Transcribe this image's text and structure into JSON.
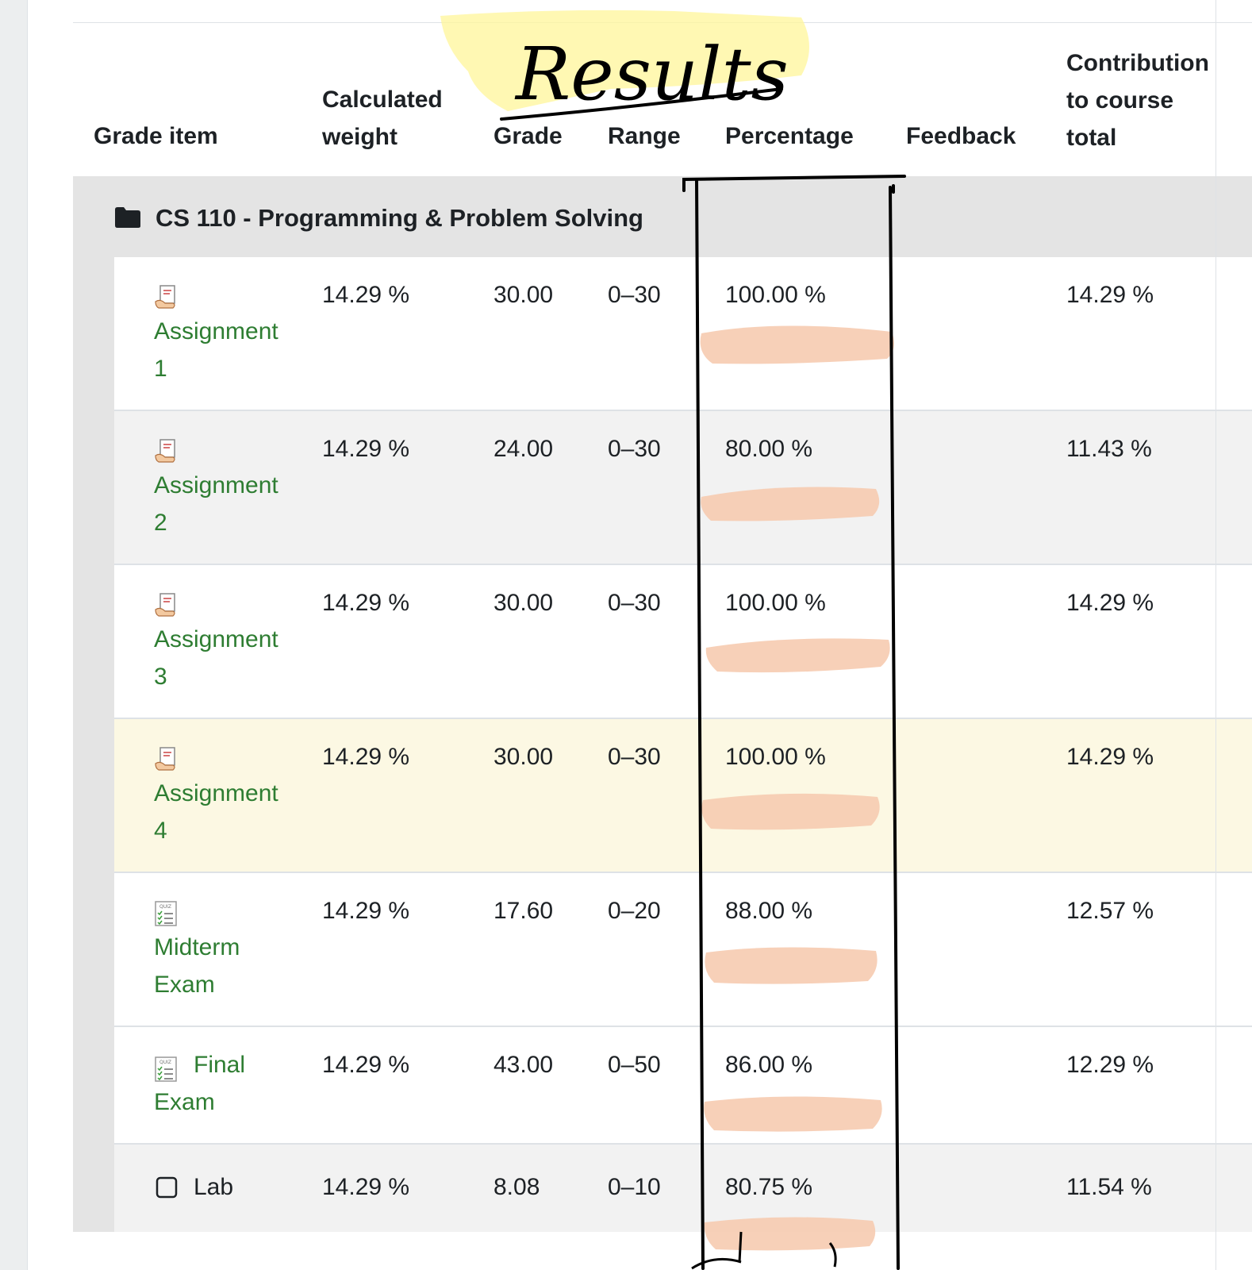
{
  "table": {
    "headers": {
      "grade_item": "Grade item",
      "calculated_weight_line1": "Calculated",
      "calculated_weight_line2": "weight",
      "grade": "Grade",
      "range": "Range",
      "percentage": "Percentage",
      "feedback": "Feedback",
      "contribution_line1": "Contribution",
      "contribution_line2": "to course",
      "contribution_line3": "total"
    },
    "category": {
      "title": "CS 110 - Programming & Problem Solving",
      "icon": "folder-icon"
    },
    "rows": [
      {
        "name_line1": "Assignment",
        "name_line2": "1",
        "icon": "assignment-icon",
        "weight": "14.29 %",
        "grade": "30.00",
        "range": "0–30",
        "percentage": "100.00 %",
        "feedback": "",
        "contribution": "14.29 %"
      },
      {
        "name_line1": "Assignment",
        "name_line2": "2",
        "icon": "assignment-icon",
        "weight": "14.29 %",
        "grade": "24.00",
        "range": "0–30",
        "percentage": "80.00 %",
        "feedback": "",
        "contribution": "11.43 %"
      },
      {
        "name_line1": "Assignment",
        "name_line2": "3",
        "icon": "assignment-icon",
        "weight": "14.29 %",
        "grade": "30.00",
        "range": "0–30",
        "percentage": "100.00 %",
        "feedback": "",
        "contribution": "14.29 %"
      },
      {
        "name_line1": "Assignment",
        "name_line2": "4",
        "icon": "assignment-icon",
        "weight": "14.29 %",
        "grade": "30.00",
        "range": "0–30",
        "percentage": "100.00 %",
        "feedback": "",
        "contribution": "14.29 %"
      },
      {
        "name_line1": "Midterm",
        "name_line2": "Exam",
        "icon": "quiz-icon",
        "weight": "14.29 %",
        "grade": "17.60",
        "range": "0–20",
        "percentage": "88.00 %",
        "feedback": "",
        "contribution": "12.57 %"
      },
      {
        "name_line1": "Final",
        "name_line2": "Exam",
        "icon": "quiz-icon",
        "weight": "14.29 %",
        "grade": "43.00",
        "range": "0–50",
        "percentage": "86.00 %",
        "feedback": "",
        "contribution": "12.29 %"
      },
      {
        "name_line1": "Lab",
        "icon": "checkbox-icon",
        "weight": "14.29 %",
        "grade": "8.08",
        "range": "0–10",
        "percentage": "80.75 %",
        "feedback": "",
        "contribution": "11.54 %"
      }
    ]
  },
  "annotation": {
    "handwritten_text": "Results",
    "highlight_color": "#fff59a",
    "redaction_color": "#f6cbb0",
    "ink_color": "#000000"
  },
  "colors": {
    "link": "#2e7d32",
    "highlight_row": "#fcf8e3",
    "category_bg": "#e4e4e4"
  }
}
